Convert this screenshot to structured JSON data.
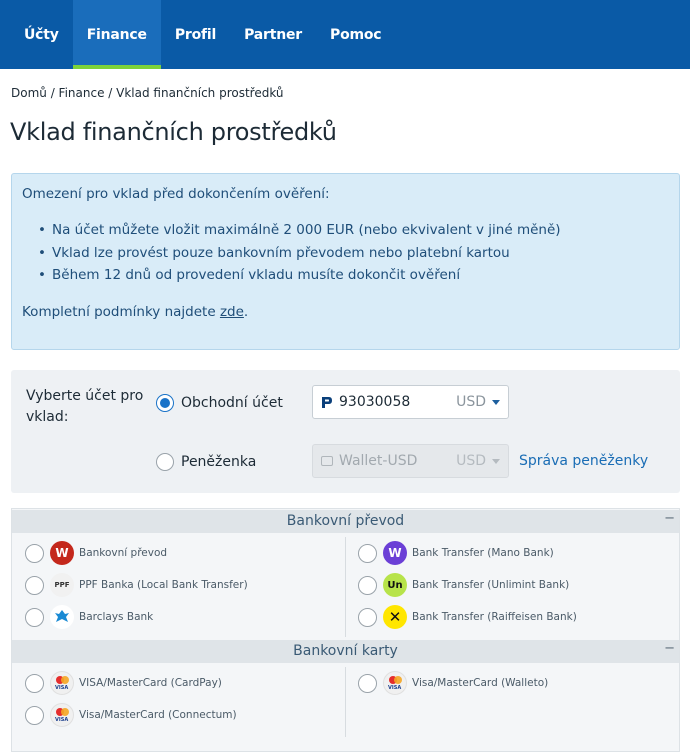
{
  "nav": {
    "tabs": [
      {
        "label": "Účty",
        "active": false
      },
      {
        "label": "Finance",
        "active": true
      },
      {
        "label": "Profil",
        "active": false
      },
      {
        "label": "Partner",
        "active": false
      },
      {
        "label": "Pomoc",
        "active": false
      }
    ]
  },
  "breadcrumb": "Domů / Finance / Vklad finančních prostředků",
  "page_title": "Vklad finančních prostředků",
  "info": {
    "heading": "Omezení pro vklad před dokončením ověření:",
    "items": [
      "Na účet můžete vložit maximálně 2 000 EUR (nebo ekvivalent v jiné měně)",
      "Vklad lze provést pouze bankovním převodem nebo platební kartou",
      "Během 12 dnů od provedení vkladu musíte dokončit ověření"
    ],
    "footer_prefix": "Kompletní podmínky najdete ",
    "footer_link": "zde",
    "footer_suffix": "."
  },
  "account": {
    "label": "Vyberte účet pro vklad:",
    "trading_label": "Obchodní účet",
    "trading_selected": true,
    "trading_number": "93030058",
    "trading_currency": "USD",
    "wallet_label": "Peněženka",
    "wallet_selected": false,
    "wallet_value": "Wallet-USD",
    "wallet_currency": "USD",
    "wallet_manage": "Správa peněženky"
  },
  "sections": {
    "bank_transfer": {
      "title": "Bankovní převod",
      "toggle": "−",
      "left": [
        "Bankovní převod",
        "PPF Banka (Local Bank Transfer)",
        "Barclays Bank"
      ],
      "right": [
        "Bank Transfer (Mano Bank)",
        "Bank Transfer (Unlimint Bank)",
        "Bank Transfer (Raiffeisen Bank)"
      ]
    },
    "bank_cards": {
      "title": "Bankovní karty",
      "toggle": "−",
      "left": [
        "VISA/MasterCard (CardPay)",
        "Visa/MasterCard (Connectum)"
      ],
      "right": [
        "Visa/MasterCard (Walleto)"
      ]
    }
  },
  "icons": {
    "bank_transfer": "bank-w-icon",
    "ppf": "ppf-icon",
    "barclays": "eagle-icon",
    "mano": "mano-w-icon",
    "unlimint": "un-icon",
    "raiffeisen": "raiffeisen-x-icon",
    "card": "visa-mastercard-icon"
  },
  "colors": {
    "nav_bg": "#0a5aa6",
    "nav_active_underline": "#7dd23a",
    "info_bg": "#d9ecf8",
    "link": "#1a6db5"
  }
}
